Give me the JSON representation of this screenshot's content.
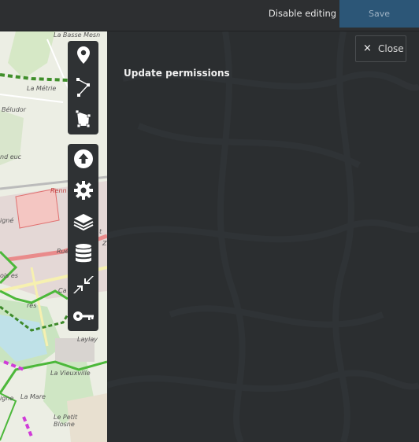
{
  "header": {
    "disable_editing_label": "Disable editing",
    "save_label": "Save"
  },
  "panel": {
    "close_label": "Close",
    "close_icon_glyph": "×",
    "title": "Update permissions"
  },
  "map": {
    "place_labels": [
      "La Basse Mesn",
      "La Métrie",
      "Béludor",
      "nd euc",
      "Renn",
      "igné",
      "Rue",
      "ois es",
      "Ca",
      "res",
      "La Vieuxville",
      "igne",
      "La Mare",
      "Le Petit Blosne",
      "Laylay",
      "Z",
      "t"
    ]
  },
  "toolbar": {
    "draw_tools": [
      "marker-icon",
      "polyline-icon",
      "polygon-icon"
    ],
    "settings_tools": [
      "upload-icon",
      "gear-icon",
      "layers-icon",
      "database-icon",
      "collapse-arrows-icon",
      "key-icon"
    ]
  }
}
